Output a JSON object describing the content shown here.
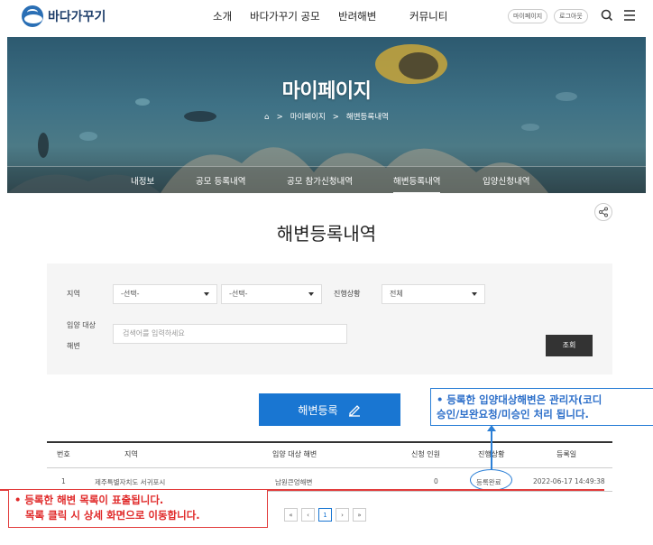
{
  "header": {
    "logo_text": "바다가꾸기",
    "nav": [
      "소개",
      "바다가꾸기 공모",
      "반려해변",
      "커뮤니티"
    ],
    "mypage_label": "마이페이지",
    "logout_label": "로그아웃"
  },
  "hero": {
    "title": "마이페이지",
    "breadcrumb": [
      "마이페이지",
      "해변등록내역"
    ],
    "tabs": [
      "내정보",
      "공모 등록내역",
      "공모 참가신청내역",
      "해변등록내역",
      "입양신청내역"
    ],
    "active_tab": "해변등록내역"
  },
  "page_title": "해변등록내역",
  "search": {
    "region_label": "지역",
    "region_select1": "-선택-",
    "region_select2": "-선택-",
    "status_label": "진행상황",
    "status_select": "전체",
    "beach_label_line1": "입양 대상",
    "beach_label_line2": "해변",
    "beach_placeholder": "검색어를 입력하세요",
    "search_button": "조회"
  },
  "register_button": "해변등록",
  "table": {
    "headers": [
      "번호",
      "지역",
      "입양 대상 해변",
      "신청 인원",
      "진행상황",
      "등록일"
    ],
    "rows": [
      {
        "no": "1",
        "region": "제주특별자치도 서귀포시",
        "beach": "남원큰엉해변",
        "count": "0",
        "status": "등록완료",
        "date": "2022-06-17 14:49:38"
      }
    ]
  },
  "pagination": {
    "first": "«",
    "prev": "‹",
    "current": "1",
    "next": "›",
    "last": "»"
  },
  "annotations": {
    "blue_line1": "• 등록한 입양대상해변은 관리자(코디",
    "blue_line2": "승인/보완요청/미승인 처리 됩니다.",
    "red_line1": "• 등록한 해변 목록이 표출됩니다.",
    "red_line2": "목록 클릭 시 상세 화면으로 이동합니다."
  },
  "colors": {
    "primary": "#1976d2",
    "annotation_blue": "#2b7fd6",
    "annotation_red": "#e23b3b"
  }
}
